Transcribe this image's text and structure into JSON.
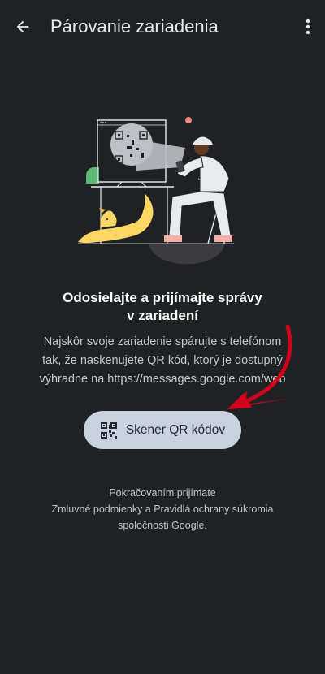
{
  "appbar": {
    "title": "Párovanie zariadenia",
    "back_icon": "arrow-back-icon",
    "more_icon": "more-vert-icon"
  },
  "illustration": {
    "description_icon": "person-scanning-qr-illustration",
    "accent_green": "#5bb974",
    "accent_yellow": "#fdd663",
    "accent_red": "#f28b82"
  },
  "content": {
    "headline": "Odosielajte a prijímajte správy\nv zariadení",
    "description": "Najskôr svoje zariadenie spárujte s telefónom\ntak, že naskenujete QR kód, ktorý je dostupný\nvýhradne na https://messages.google.com/web"
  },
  "scan_button": {
    "label": "Skener QR kódov",
    "icon": "qr-code-scanner-icon",
    "background": "#c9d0de"
  },
  "overlay": {
    "arrow_color": "#d0021b"
  },
  "footer": {
    "line1": "Pokračovaním prijímate",
    "line2": "Zmluvné podmienky a Pravidlá ochrany súkromia",
    "line3": "spoločnosti Google."
  }
}
